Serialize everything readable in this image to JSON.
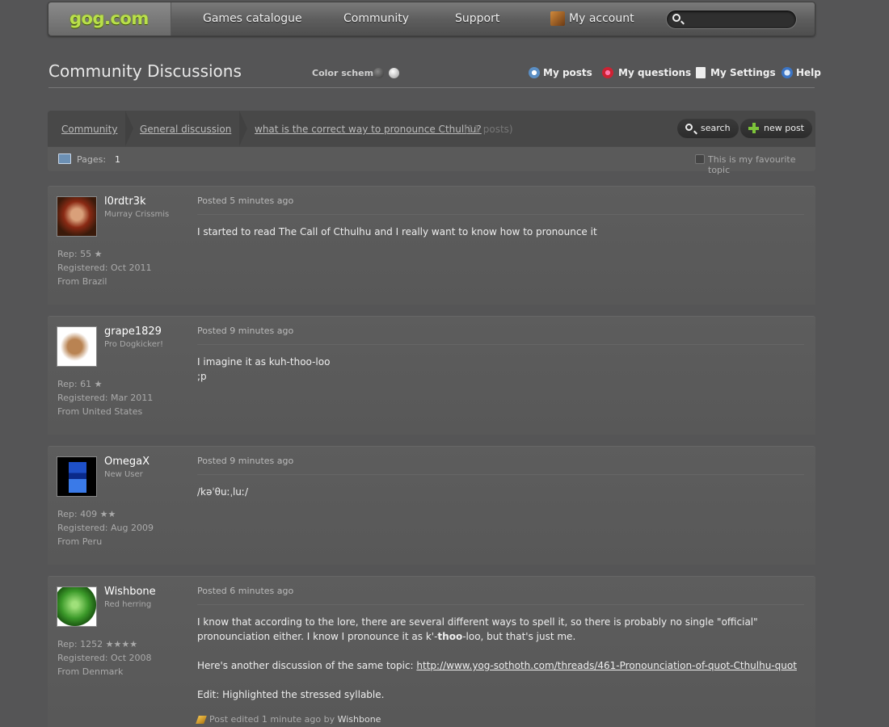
{
  "nav": {
    "logo": "gog.com",
    "links": [
      "Games catalogue",
      "Community",
      "Support"
    ],
    "account": "My account",
    "search_placeholder": ""
  },
  "header": {
    "title": "Community Discussions",
    "color_scheme_label": "Color scheme",
    "links": [
      "My posts",
      "My questions",
      "My Settings",
      "Help"
    ]
  },
  "breadcrumb": {
    "items": [
      "Community",
      "General discussion",
      "what is the correct way to pronounce Cthulhu?"
    ],
    "count": "(11 posts)",
    "search_button": "search",
    "new_post_button": "new post"
  },
  "pages": {
    "label": "Pages:",
    "current": "1",
    "favourite_label": "This is my favourite topic"
  },
  "posts": [
    {
      "user": "l0rdtr3k",
      "title": "Murray Crissmis",
      "rep": "Rep: 55",
      "stars": "★",
      "registered": "Registered: Oct 2011",
      "from": "From Brazil",
      "posted": "Posted 5 minutes ago",
      "body": [
        "I started to read The Call of Cthulhu and I really want to know how to pronounce it"
      ]
    },
    {
      "user": "grape1829",
      "title": "Pro Dogkicker!",
      "rep": "Rep: 61",
      "stars": "★",
      "registered": "Registered: Mar 2011",
      "from": "From United States",
      "posted": "Posted 9 minutes ago",
      "body": [
        "I imagine it as kuh-thoo-loo",
        ";p"
      ]
    },
    {
      "user": "OmegaX",
      "title": "New User",
      "rep": "Rep: 409",
      "stars": "★★",
      "registered": "Registered: Aug 2009",
      "from": "From Peru",
      "posted": "Posted 9 minutes ago",
      "body": [
        "/kəˈθuːˌluː/"
      ]
    },
    {
      "user": "Wishbone",
      "title": "Red herring",
      "rep": "Rep: 1252",
      "stars": "★★★★",
      "registered": "Registered: Oct 2008",
      "from": "From Denmark",
      "posted": "Posted 6 minutes ago",
      "body_p1_before": "I know that according to the lore, there are several different ways to spell it, so there is probably no single \"official\" pronounciation either. I know I pronounce it as k'-",
      "body_p1_bold": "thoo",
      "body_p1_after": "-loo, but that's just me.",
      "body_p2_before": "Here's another discussion of the same topic: ",
      "body_p2_link": "http://www.yog-sothoth.com/threads/461-Pronounciation-of-quot-Cthulhu-quot",
      "body_p3": "Edit: Highlighted the stressed syllable.",
      "edited": "Post edited 1 minute ago by",
      "edited_by": "Wishbone"
    }
  ],
  "colors": {
    "background": "#555556",
    "logo_green": "#b9e04a"
  }
}
